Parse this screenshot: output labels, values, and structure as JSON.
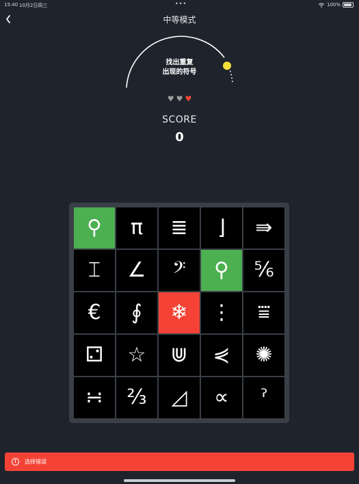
{
  "status_bar": {
    "time": "15:40",
    "date": "10月2日周三",
    "dots": "•••",
    "battery": "100%",
    "wifi_icon": "wifi-icon",
    "battery_icon": "battery-icon"
  },
  "nav": {
    "back_icon": "chevron-left-icon",
    "title": "中等模式"
  },
  "game": {
    "prompt_line1": "找出重复",
    "prompt_line2": "出现的符号",
    "timer_color": "#f5e03b",
    "lives": [
      {
        "glyph": "♥",
        "color": "#9e9e9e"
      },
      {
        "glyph": "♥",
        "color": "#9e9e9e"
      },
      {
        "glyph": "♥",
        "color": "#f44336"
      }
    ],
    "score_label": "SCORE",
    "score_value": "0"
  },
  "grid": {
    "cells": [
      {
        "symbol": "⚲",
        "state": "correct"
      },
      {
        "symbol": "π",
        "state": ""
      },
      {
        "symbol": "≣",
        "state": ""
      },
      {
        "symbol": "⌋",
        "state": ""
      },
      {
        "symbol": "⇛",
        "state": ""
      },
      {
        "symbol": "⌶",
        "state": ""
      },
      {
        "symbol": "∠",
        "state": ""
      },
      {
        "symbol": "𝄢",
        "state": ""
      },
      {
        "symbol": "⚲",
        "state": "correct"
      },
      {
        "symbol": "⅚",
        "state": ""
      },
      {
        "symbol": "€",
        "state": ""
      },
      {
        "symbol": "∮",
        "state": ""
      },
      {
        "symbol": "❄",
        "state": "wrong"
      },
      {
        "symbol": "⋮",
        "state": ""
      },
      {
        "symbol": "⩸",
        "state": ""
      },
      {
        "symbol": "⚁",
        "state": ""
      },
      {
        "symbol": "☆",
        "state": ""
      },
      {
        "symbol": "⋓",
        "state": ""
      },
      {
        "symbol": "⋞",
        "state": ""
      },
      {
        "symbol": "✺",
        "state": ""
      },
      {
        "symbol": "∺",
        "state": ""
      },
      {
        "symbol": "⅔",
        "state": ""
      },
      {
        "symbol": "◿",
        "state": ""
      },
      {
        "symbol": "∝",
        "state": ""
      },
      {
        "symbol": "ˀ",
        "state": ""
      }
    ],
    "colors": {
      "correct": "#4caf50",
      "wrong": "#f44336"
    }
  },
  "error": {
    "icon": "exclamation-circle-icon",
    "icon_glyph": "!",
    "message": "选择错误"
  }
}
